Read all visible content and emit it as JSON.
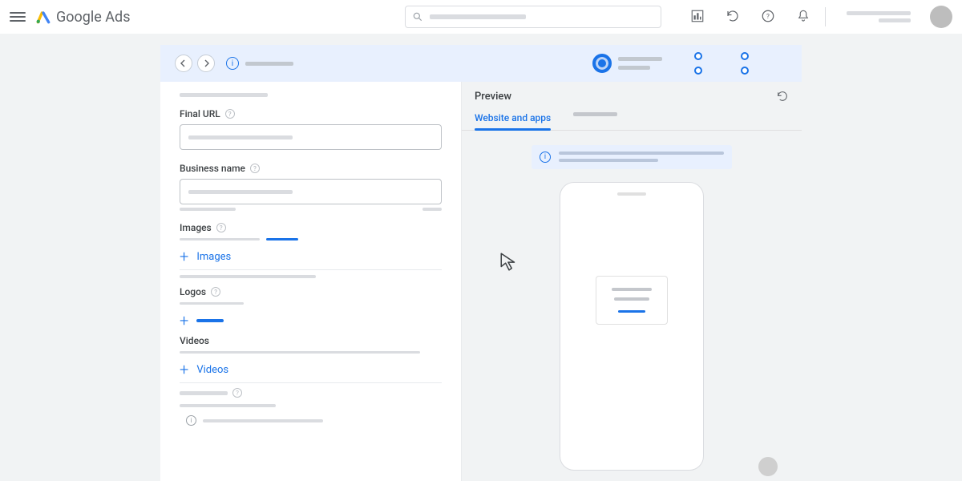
{
  "header": {
    "logo_text": "Google",
    "logo_suffix": "Ads"
  },
  "stepper": {},
  "form": {
    "final_url_label": "Final URL",
    "business_name_label": "Business name",
    "images_label": "Images",
    "images_add": "Images",
    "logos_label": "Logos",
    "videos_label": "Videos",
    "videos_add": "Videos"
  },
  "preview": {
    "title": "Preview",
    "tab_active": "Website and apps"
  }
}
